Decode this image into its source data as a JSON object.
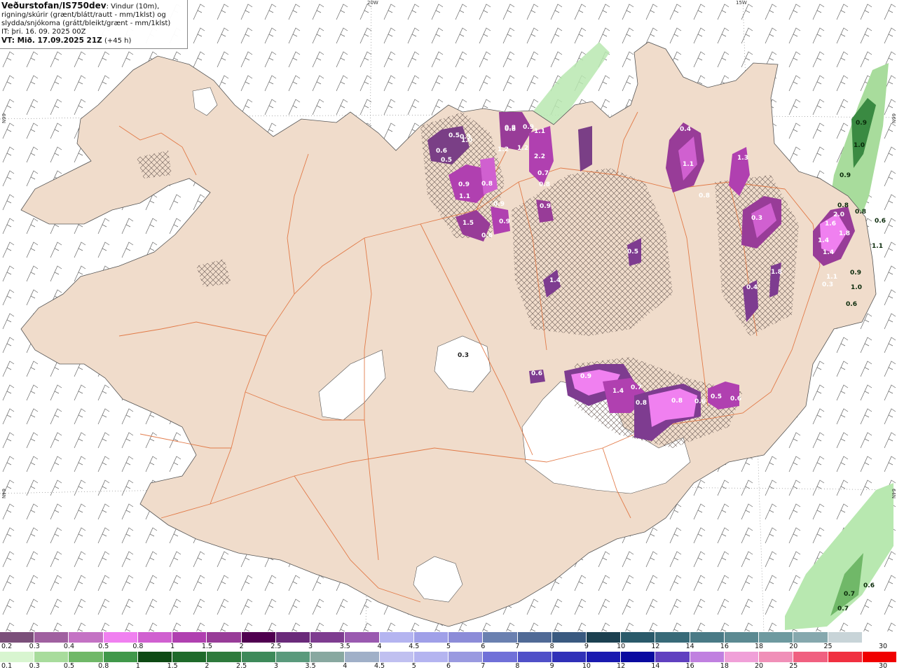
{
  "header": {
    "brand": "Veðurstofan/IS750dev",
    "description_1": ": Vindur (10m),",
    "description_2": "rigning/skúrir (grænt/blátt/rautt - mm/1klst) og",
    "description_3": "slydda/snjókoma (grátt/bleikt/grænt - mm/1klst)",
    "issue_time": "IT: þri. 16. 09. 2025 00Z",
    "valid_time": "VT: Mið. 17.09.2025 21Z",
    "lead": " (+45 h)"
  },
  "graticule": {
    "lon_labels": [
      "20W",
      "15W"
    ],
    "lat_labels": [
      "66N",
      "64N"
    ]
  },
  "precip_labels": {
    "magenta": [
      "0.5",
      "0.9",
      "0.5",
      "1.0",
      "0.6",
      "0.8",
      "0.9",
      "1.1",
      "0.9",
      "1.2",
      "1.1",
      "1.5",
      "0.6",
      "0.9",
      "0.9",
      "0.8",
      "1.2",
      "2.2",
      "0.7",
      "0.8",
      "0.9",
      "0.8",
      "0.4",
      "1.1",
      "1.3",
      "0.8",
      "0.5",
      "1.4",
      "0.3",
      "0.3",
      "1.6",
      "1.4",
      "0.4",
      "1.8",
      "2.0",
      "1.1",
      "1.8",
      "1.4",
      "0.3",
      "0.6",
      "0.9",
      "1.4",
      "0.7",
      "0.8",
      "0.8",
      "0.6",
      "0.5",
      "0.6"
    ],
    "green_text": [
      "0.9",
      "1.0",
      "0.9",
      "0.8",
      "0.8",
      "0.6",
      "1.1",
      "0.9",
      "1.0",
      "0.6",
      "0.6",
      "0.7",
      "0.7"
    ]
  },
  "scales": {
    "top": {
      "labels": [
        "0.2",
        "0.3",
        "0.4",
        "0.5",
        "0.8",
        "1",
        "1.5",
        "2",
        "2.5",
        "3",
        "3.5",
        "4",
        "4.5",
        "5",
        "6",
        "7",
        "8",
        "9",
        "10",
        "12",
        "14",
        "16",
        "18",
        "20",
        "25",
        "30"
      ],
      "colors": [
        "#7b4f7a",
        "#a060a0",
        "#c472c4",
        "#f080f0",
        "#d060d0",
        "#b040b0",
        "#983c98",
        "#500050",
        "#6a2a7a",
        "#7e3c90",
        "#9a5ab0",
        "#b4b4f0",
        "#a0a0e8",
        "#8c8cd8",
        "#6a80b0",
        "#506a96",
        "#3a5a80",
        "#1c4050",
        "#2a5a6a",
        "#386a78",
        "#4a7a86",
        "#5c8a92",
        "#6e9aa0",
        "#86a8ae",
        "#c8d4d8",
        "#ffffff"
      ]
    },
    "bottom": {
      "labels": [
        "0.1",
        "0.3",
        "0.5",
        "0.8",
        "1",
        "1.5",
        "2",
        "2.5",
        "3",
        "3.5",
        "4",
        "4.5",
        "5",
        "6",
        "7",
        "8",
        "9",
        "10",
        "12",
        "14",
        "16",
        "18",
        "20",
        "25",
        "30"
      ],
      "colors": [
        "#d8f5d0",
        "#a8dc9c",
        "#70b868",
        "#40984a",
        "#0e4a14",
        "#1e6a2a",
        "#2e7a3c",
        "#3e8a5a",
        "#5a9a7c",
        "#88a8a0",
        "#a0b0c8",
        "#c0c0f0",
        "#b4b4f0",
        "#9a9ae0",
        "#7070d8",
        "#5050c8",
        "#3030b8",
        "#1a1ab0",
        "#0a0aa0",
        "#6040c0",
        "#c080e0",
        "#f0a0d8",
        "#f090b8",
        "#f06080",
        "#f03040",
        "#f00000"
      ]
    }
  }
}
